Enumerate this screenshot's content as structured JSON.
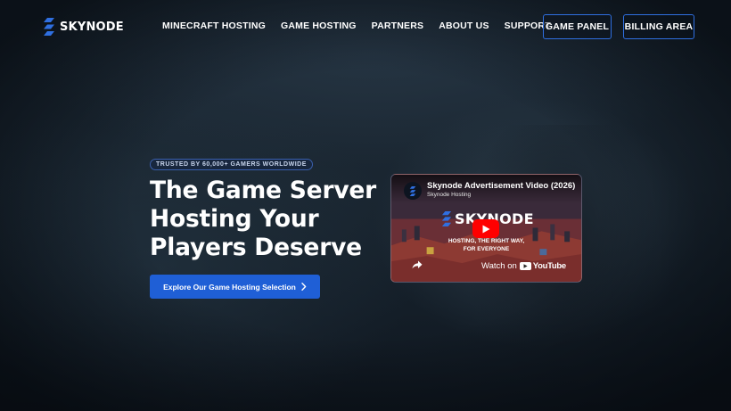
{
  "brand": {
    "name": "SKYNODE",
    "accent_color": "#1f5fd6",
    "logo_icon": "skynode-slash-logo-icon"
  },
  "nav": {
    "items": [
      {
        "label": "MINECRAFT HOSTING"
      },
      {
        "label": "GAME HOSTING"
      },
      {
        "label": "PARTNERS"
      },
      {
        "label": "ABOUT US"
      },
      {
        "label": "SUPPORT"
      }
    ],
    "game_panel_label": "GAME PANEL",
    "billing_area_label": "BILLING AREA"
  },
  "hero": {
    "badge": "TRUSTED BY 60,000+ GAMERS WORLDWIDE",
    "title_lines": [
      "The Game Server",
      "Hosting Your",
      "Players Deserve"
    ],
    "cta_label": "Explore Our Game Hosting Selection",
    "cta_icon": "chevron-right-icon"
  },
  "video": {
    "title": "Skynode Advertisement Video (2026)",
    "channel": "Skynode Hosting",
    "logo_text": "SKYNODE",
    "tagline_line1": "HOSTING, THE RIGHT WAY,",
    "tagline_line2": "FOR EVERYONE",
    "watch_on_label": "Watch on",
    "youtube_label": "YouTube",
    "play_color": "#ff0000"
  }
}
